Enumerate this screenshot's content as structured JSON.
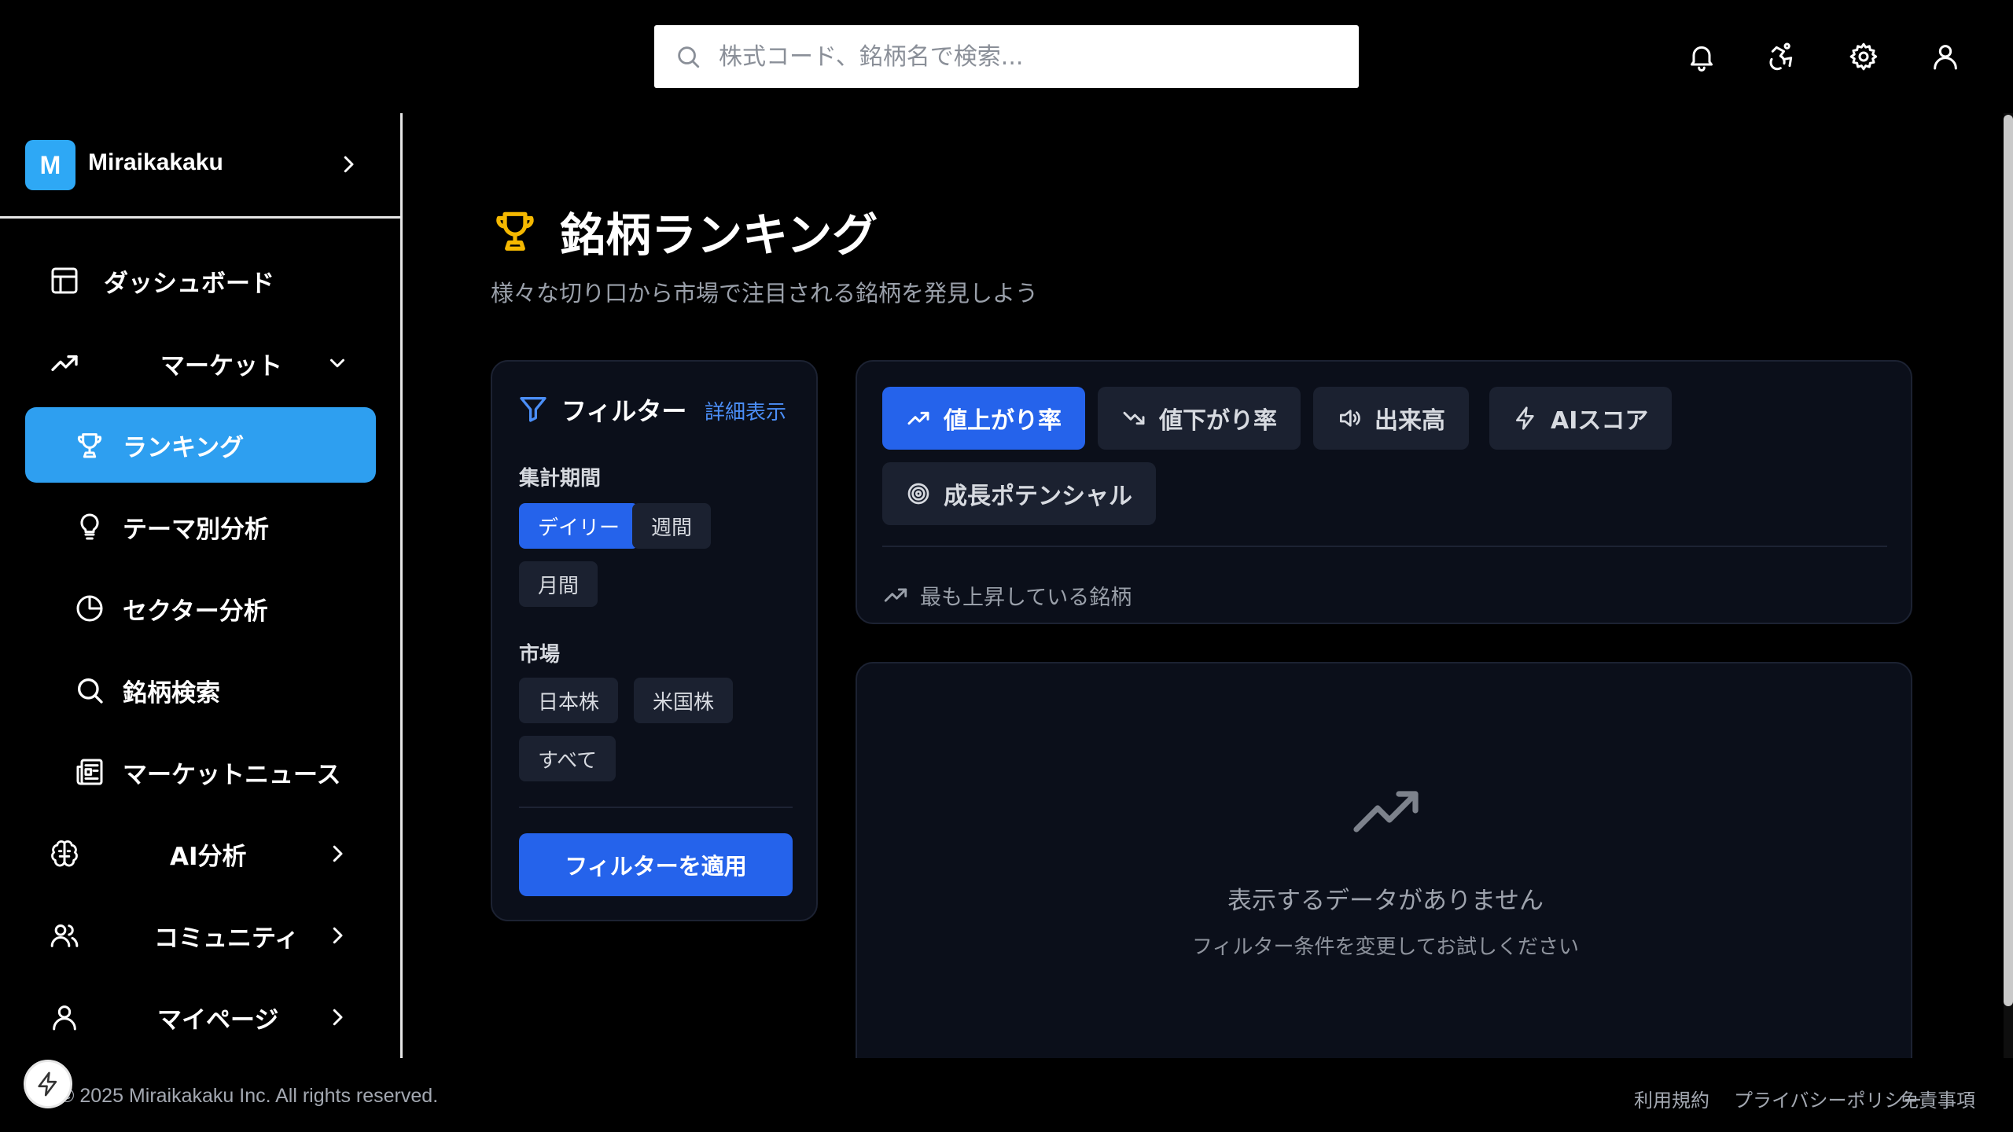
{
  "search": {
    "placeholder": "株式コード、銘柄名で検索..."
  },
  "header_icons": [
    "bell-icon",
    "accessibility-icon",
    "gear-icon",
    "user-icon"
  ],
  "sidebar": {
    "brand": {
      "logo_letter": "M",
      "name": "Miraikakaku"
    },
    "items": [
      {
        "label": "ダッシュボード",
        "icon": "layout-icon"
      },
      {
        "label": "マーケット",
        "icon": "trending-up-icon"
      },
      {
        "label": "ランキング",
        "icon": "trophy-icon"
      },
      {
        "label": "テーマ別分析",
        "icon": "lightbulb-icon"
      },
      {
        "label": "セクター分析",
        "icon": "pie-chart-icon"
      },
      {
        "label": "銘柄検索",
        "icon": "search-icon"
      },
      {
        "label": "マーケットニュース",
        "icon": "newspaper-icon"
      },
      {
        "label": "AI分析",
        "icon": "brain-icon"
      },
      {
        "label": "コミュニティ",
        "icon": "users-icon"
      },
      {
        "label": "マイページ",
        "icon": "user-icon"
      }
    ]
  },
  "page": {
    "title": "銘柄ランキング",
    "subtitle": "様々な切り口から市場で注目される銘柄を発見しよう"
  },
  "filter": {
    "title": "フィルター",
    "detail_link": "詳細表示",
    "period_label": "集計期間",
    "periods": [
      "デイリー",
      "週間",
      "月間"
    ],
    "market_label": "市場",
    "markets": [
      "日本株",
      "米国株",
      "すべて"
    ],
    "apply_label": "フィルターを適用"
  },
  "ranking_tabs": {
    "tabs": [
      "値上がり率",
      "値下がり率",
      "出来高",
      "AIスコア",
      "成長ポテンシャル"
    ],
    "active": "値上がり率",
    "description": "最も上昇している銘柄"
  },
  "empty_state": {
    "title": "表示するデータがありません",
    "subtitle": "フィルター条件を変更してお試しください"
  },
  "footer": {
    "copyright": "2025 Miraikakaku Inc. All rights reserved.",
    "links": [
      "利用規約",
      "プライバシーポリシー",
      "免責事項"
    ]
  },
  "colors": {
    "accent": "#2563eb",
    "sidebar_active": "#2e9ff0",
    "trophy": "#f5b800",
    "panel_bg": "#0b0f1a"
  }
}
